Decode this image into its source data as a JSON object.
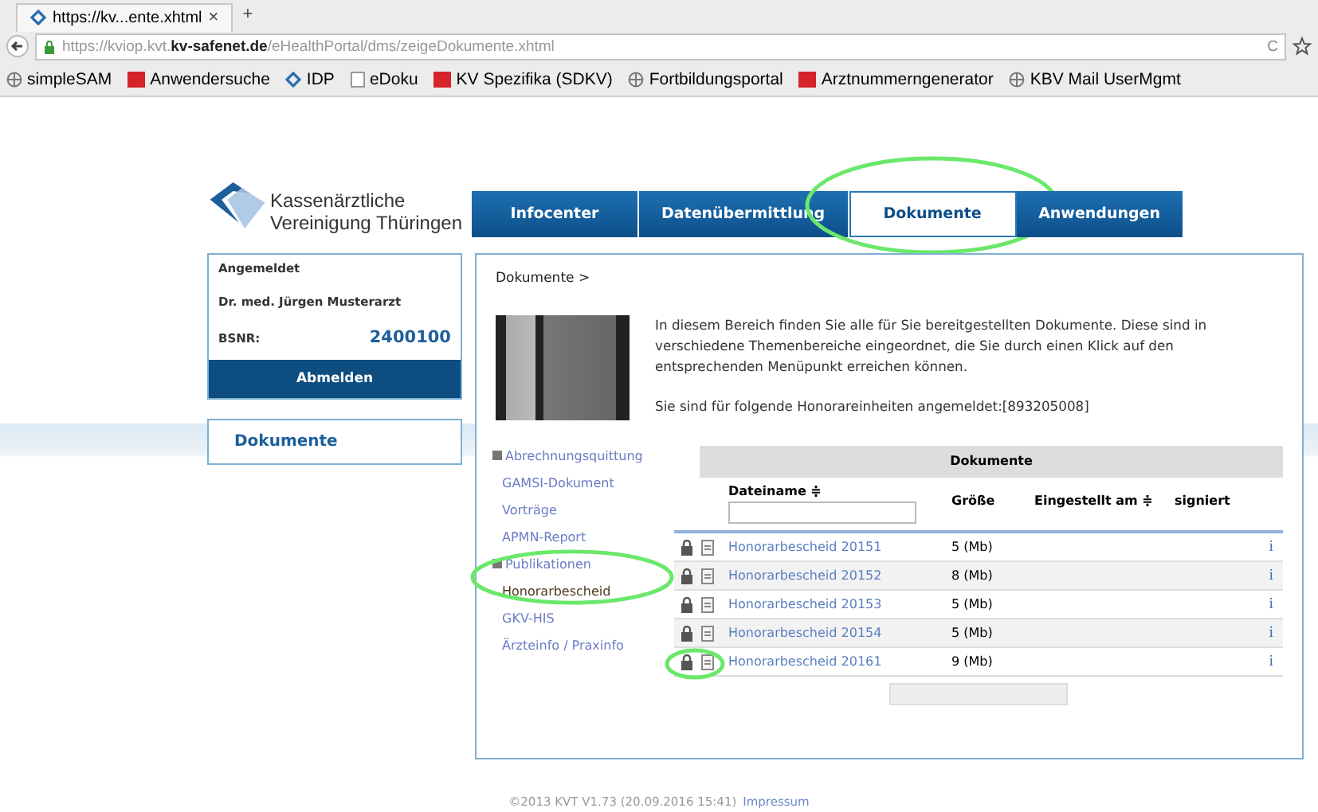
{
  "browser": {
    "tab_title": "https://kv...ente.xhtml",
    "tab_close": "×",
    "new_tab": "+",
    "url_prefix": "https://kviop.kvt.",
    "url_domain": "kv-safenet.de",
    "url_path": "/eHealthPortal/dms/zeigeDokumente.xhtml",
    "reload": "C"
  },
  "bookmarks": [
    {
      "label": "simpleSAM",
      "kind": "page"
    },
    {
      "label": "Anwendersuche",
      "kind": "red"
    },
    {
      "label": "IDP",
      "kind": "diamond"
    },
    {
      "label": "eDoku",
      "kind": "doc"
    },
    {
      "label": "KV Spezifika (SDKV)",
      "kind": "red"
    },
    {
      "label": "Fortbildungsportal",
      "kind": "page"
    },
    {
      "label": "Arztnummerngenerator",
      "kind": "red"
    },
    {
      "label": "KBV Mail UserMgmt",
      "kind": "page"
    }
  ],
  "logo": {
    "line1": "Kassenärztliche",
    "line2": "Vereinigung Thüringen"
  },
  "nav_tabs": [
    {
      "label": "Infocenter",
      "selected": false,
      "annotated": false
    },
    {
      "label": "Datenübermittlung",
      "selected": false,
      "annotated": false
    },
    {
      "label": "Dokumente",
      "selected": true,
      "annotated": true
    },
    {
      "label": "Anwendungen",
      "selected": false,
      "annotated": false
    }
  ],
  "user_box": {
    "heading": "Angemeldet",
    "name": "Dr. med. Jürgen Musterarzt",
    "bsnr_label": "BSNR:",
    "bsnr": "2400100",
    "logout": "Abmelden"
  },
  "side_menu": [
    "Dokumente"
  ],
  "breadcrumb": "Dokumente >",
  "intro": "In diesem Bereich finden Sie alle für Sie bereitgestellten Dokumente. Diese sind in verschiedene Themenbereiche eingeordnet, die Sie durch einen Klick auf den entsprechenden Menüpunkt erreichen können.",
  "units": "Sie sind für folgende Honorareinheiten angemeldet:[893205008]",
  "tree": [
    {
      "label": "Abrechnungsquittung",
      "kind": "group",
      "selected": false,
      "annotated": false
    },
    {
      "label": "GAMSI-Dokument",
      "kind": "item",
      "selected": false,
      "annotated": false
    },
    {
      "label": "Vorträge",
      "kind": "item",
      "selected": false,
      "annotated": false
    },
    {
      "label": "APMN-Report",
      "kind": "item",
      "selected": false,
      "annotated": false
    },
    {
      "label": "Publikationen",
      "kind": "group",
      "selected": false,
      "annotated": true
    },
    {
      "label": "Honorarbescheid",
      "kind": "item",
      "selected": true,
      "annotated": true
    },
    {
      "label": "GKV-HIS",
      "kind": "item",
      "selected": false,
      "annotated": false
    },
    {
      "label": "Ärzteinfo / Praxinfo",
      "kind": "item",
      "selected": false,
      "annotated": false
    }
  ],
  "table": {
    "title": "Dokumente",
    "columns": [
      "Dateiname ≑",
      "Größe",
      "Eingestellt am ≑",
      "signiert"
    ],
    "rows": [
      {
        "name": "Honorarbescheid 20151",
        "size": "5 (Mb)",
        "signed": "i",
        "annotated": false
      },
      {
        "name": "Honorarbescheid 20152",
        "size": "8 (Mb)",
        "signed": "i",
        "annotated": false
      },
      {
        "name": "Honorarbescheid 20153",
        "size": "5 (Mb)",
        "signed": "i",
        "annotated": false
      },
      {
        "name": "Honorarbescheid 20154",
        "size": "5 (Mb)",
        "signed": "i",
        "annotated": false
      },
      {
        "name": "Honorarbescheid 20161",
        "size": "9 (Mb)",
        "signed": "i",
        "annotated": true
      }
    ]
  },
  "footer": {
    "text": "©2013 KVT V1.73 (20.09.2016 15:41)",
    "link": "Impressum"
  }
}
